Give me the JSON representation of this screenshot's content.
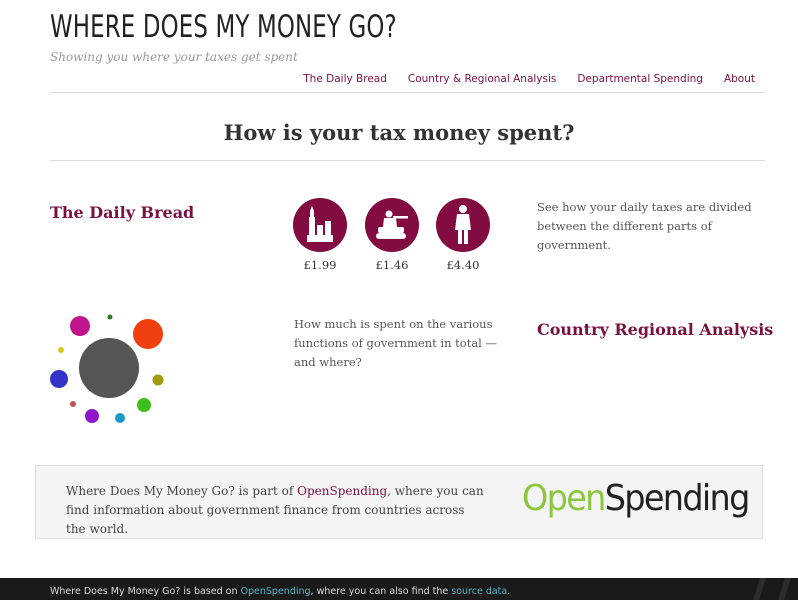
{
  "header": {
    "title": "WHERE DOES MY MONEY GO?",
    "tagline": "Showing you where your taxes get spent"
  },
  "nav": [
    {
      "label": "The Daily Bread"
    },
    {
      "label": "Country & Regional Analysis"
    },
    {
      "label": "Departmental Spending"
    },
    {
      "label": "About"
    }
  ],
  "main": {
    "heading": "How is your tax money spent?",
    "daily_bread": {
      "title": "The Daily Bread",
      "items": [
        {
          "icon": "government-building-icon",
          "amount": "£1.99"
        },
        {
          "icon": "soldier-tank-icon",
          "amount": "£1.46"
        },
        {
          "icon": "person-icon",
          "amount": "£4.40"
        }
      ],
      "description": "See how your daily taxes are divided between the different parts of government."
    },
    "country_regional": {
      "title": "Country Regional Analysis",
      "description": "How much is spent on the various functions of government in total — and where?"
    }
  },
  "banner": {
    "text_before": "Where Does My Money Go? is part of ",
    "link_text": "OpenSpending",
    "text_after": ", where you can find information about government finance from countries across the world.",
    "logo_part1": "Open",
    "logo_part2": "Spending",
    "logo_color1": "#8dc63f",
    "logo_color2": "#222222"
  },
  "footer": {
    "text_before": "Where Does My Money Go? is based on ",
    "link1": "OpenSpending",
    "text_middle": ", where you can also find the ",
    "link2": "source data",
    "text_after": "."
  },
  "colors": {
    "accent": "#820c41",
    "footer_bg": "#1a1a1a",
    "footer_link": "#5bb5c9"
  }
}
